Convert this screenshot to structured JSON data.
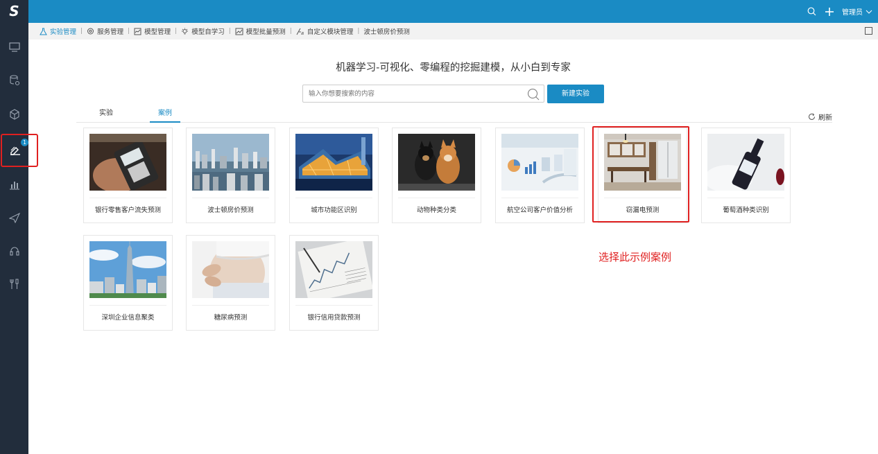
{
  "app": {
    "logo": "S"
  },
  "topbar": {
    "user_label": "管理员"
  },
  "sidebar": {
    "items": [
      {
        "icon": "monitor-icon"
      },
      {
        "icon": "database-settings-icon"
      },
      {
        "icon": "cube-icon"
      },
      {
        "icon": "model-pen-icon",
        "badge": "1"
      },
      {
        "icon": "bar-chart-icon"
      },
      {
        "icon": "send-icon"
      },
      {
        "icon": "headset-icon"
      },
      {
        "icon": "tools-icon"
      }
    ]
  },
  "breadcrumb": {
    "items": [
      {
        "label": "实验管理",
        "icon": "flask-icon"
      },
      {
        "label": "服务管理",
        "icon": "service-icon"
      },
      {
        "label": "模型管理",
        "icon": "model-icon"
      },
      {
        "label": "模型自学习",
        "icon": "bulb-icon"
      },
      {
        "label": "模型批量预测",
        "icon": "line-chart-icon"
      },
      {
        "label": "自定义模块管理",
        "icon": "custom-module-icon"
      },
      {
        "label": "波士顿房价预测",
        "icon": ""
      }
    ]
  },
  "main": {
    "headline": "机器学习-可视化、零编程的挖掘建模，从小白到专家",
    "search": {
      "placeholder": "输入你想要搜索的内容"
    },
    "new_button": "新建实验",
    "tabs": [
      {
        "label": "实验"
      },
      {
        "label": "案例"
      }
    ],
    "refresh_label": "刷新",
    "cases": [
      {
        "label": "银行零售客户流失预测",
        "image": "pos-terminal"
      },
      {
        "label": "波士顿房价预测",
        "image": "city-harbor"
      },
      {
        "label": "城市功能区识别",
        "image": "glass-building"
      },
      {
        "label": "动物种类分类",
        "image": "dogs"
      },
      {
        "label": "航空公司客户价值分析",
        "image": "charts-screen"
      },
      {
        "label": "窃漏电预测",
        "image": "kitchen"
      },
      {
        "label": "葡萄酒种类识别",
        "image": "wine-bottle"
      },
      {
        "label": "深圳企业信息聚类",
        "image": "skyscraper"
      },
      {
        "label": "糖尿病预测",
        "image": "belly"
      },
      {
        "label": "银行信用贷款预测",
        "image": "newspaper-chart"
      }
    ],
    "annotation": "选择此示例案例"
  },
  "colors": {
    "accent": "#1a8bc4",
    "sidebar": "#222d3c",
    "highlight": "#e02020"
  }
}
